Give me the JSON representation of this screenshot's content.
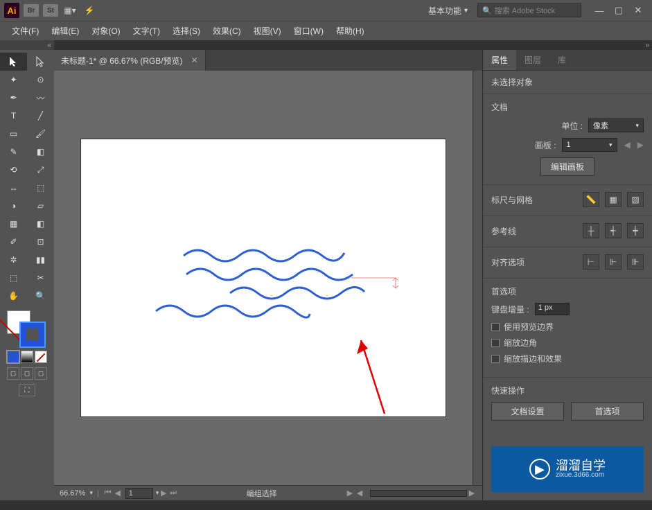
{
  "top": {
    "ai_label": "Ai",
    "br_label": "Br",
    "st_label": "St",
    "workspace": "基本功能",
    "search_placeholder": "搜索 Adobe Stock"
  },
  "menu": {
    "items": [
      "文件(F)",
      "编辑(E)",
      "对象(O)",
      "文字(T)",
      "选择(S)",
      "效果(C)",
      "视图(V)",
      "窗口(W)",
      "帮助(H)"
    ]
  },
  "doc_tab": {
    "title": "未标题-1* @ 66.67% (RGB/预览)"
  },
  "status": {
    "zoom": "66.67%",
    "artboard_num": "1",
    "center_text": "编组选择"
  },
  "panel": {
    "tabs": {
      "props": "属性",
      "layers": "图层",
      "libs": "库"
    },
    "no_selection": "未选择对象",
    "document": {
      "title": "文档",
      "units_label": "单位 :",
      "units_value": "像素",
      "artboard_label": "画板 :",
      "artboard_value": "1",
      "edit_btn": "编辑画板"
    },
    "ruler_grid": "标尺与网格",
    "guides": "参考线",
    "align_opts": "对齐选项",
    "prefs": {
      "title": "首选项",
      "kbd_inc_label": "键盘增量 :",
      "kbd_inc_value": "1 px",
      "use_preview": "使用预览边界",
      "scale_corners": "缩放边角",
      "scale_strokes": "缩放描边和效果"
    },
    "quick": {
      "title": "快速操作",
      "doc_setup": "文档设置",
      "prefs_btn": "首选项"
    }
  },
  "logo": {
    "text": "溜溜自学",
    "sub": "zixue.3d66.com"
  }
}
